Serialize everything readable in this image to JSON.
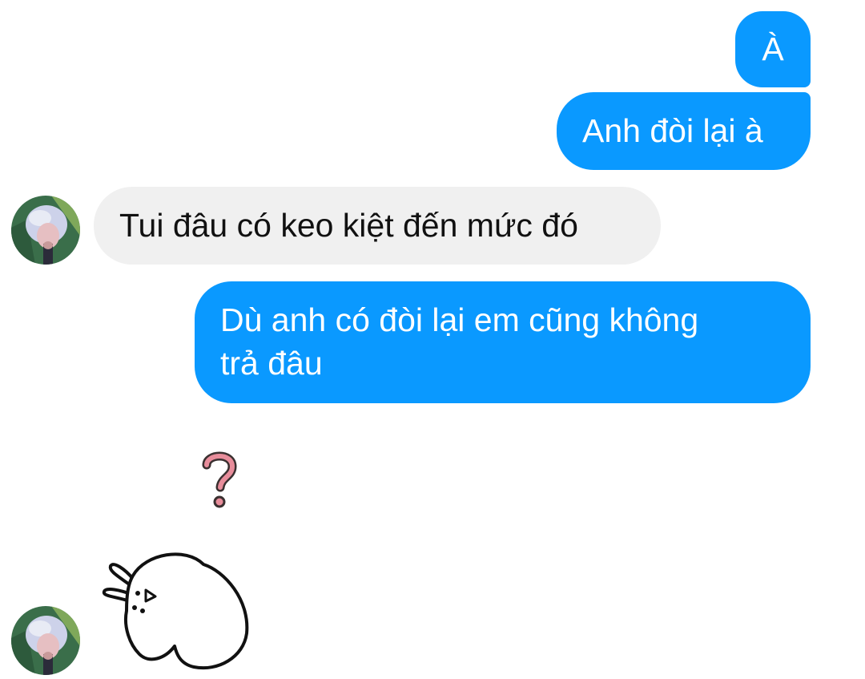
{
  "conversation": {
    "messages": [
      {
        "direction": "sent",
        "text": "À"
      },
      {
        "direction": "sent",
        "text": "Anh đòi lại à"
      },
      {
        "direction": "received",
        "text": "Tui đâu có keo kiệt đến mức đó"
      },
      {
        "direction": "sent",
        "lines": [
          "Dù anh có đòi lại em cũng không",
          "trả đâu"
        ]
      }
    ],
    "stickers": [
      {
        "icon": "question-mark-sticker-icon",
        "color": "#e88d9b"
      },
      {
        "icon": "bunny-sticker-icon"
      }
    ]
  },
  "theme": {
    "sent_bubble": "#0a99ff",
    "received_bubble": "#f0f0f0",
    "background": "#ffffff"
  }
}
